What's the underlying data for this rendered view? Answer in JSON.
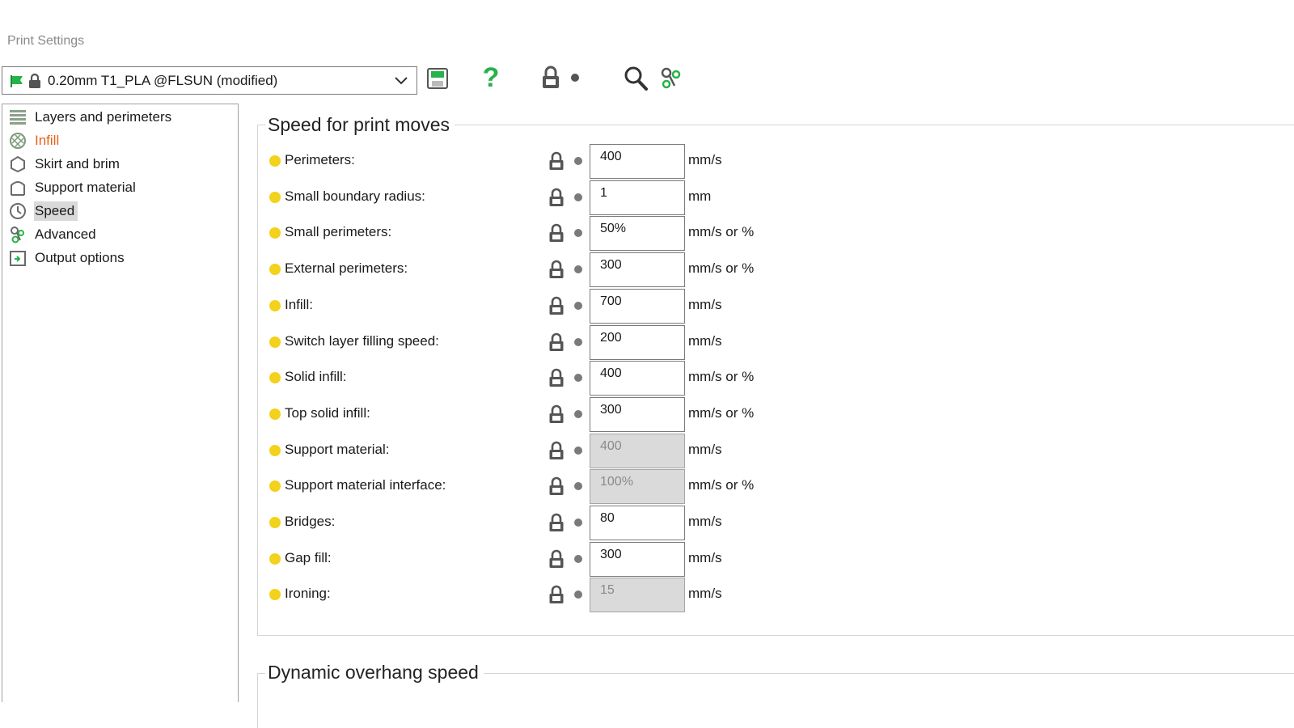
{
  "window": {
    "title": "Print Settings"
  },
  "toolbar": {
    "preset_value": "0.20mm T1_PLA @FLSUN (modified)",
    "help_glyph": "?",
    "icons": [
      "save-preset-icon",
      "help-icon",
      "lock-icon",
      "dot-icon",
      "search-icon",
      "compare-presets-icon"
    ]
  },
  "colors": {
    "accent_green": "#27b24a",
    "active_orange": "#e8601a",
    "bullet_yellow": "#f2d21b",
    "selected_bg": "#d9d9d9",
    "disabled_input_bg": "#dadada"
  },
  "sidebar": {
    "items": [
      {
        "label": "Layers and perimeters",
        "icon": "layers-icon",
        "state": "normal"
      },
      {
        "label": "Infill",
        "icon": "infill-icon",
        "state": "modified"
      },
      {
        "label": "Skirt and brim",
        "icon": "skirt-icon",
        "state": "normal"
      },
      {
        "label": "Support material",
        "icon": "support-icon",
        "state": "normal"
      },
      {
        "label": "Speed",
        "icon": "speed-icon",
        "state": "selected"
      },
      {
        "label": "Advanced",
        "icon": "advanced-icon",
        "state": "normal"
      },
      {
        "label": "Output options",
        "icon": "output-icon",
        "state": "normal"
      }
    ]
  },
  "main": {
    "group_title": "Speed for print moves",
    "group2_title": "Dynamic overhang speed",
    "rows": [
      {
        "label": "Perimeters:",
        "value": "400",
        "unit": "mm/s",
        "disabled": false
      },
      {
        "label": "Small boundary radius:",
        "value": "1",
        "unit": "mm",
        "disabled": false
      },
      {
        "label": "Small perimeters:",
        "value": "50%",
        "unit": "mm/s or %",
        "disabled": false
      },
      {
        "label": "External perimeters:",
        "value": "300",
        "unit": "mm/s or %",
        "disabled": false
      },
      {
        "label": "Infill:",
        "value": "700",
        "unit": "mm/s",
        "disabled": false
      },
      {
        "label": "Switch layer filling speed:",
        "value": "200",
        "unit": "mm/s",
        "disabled": false
      },
      {
        "label": "Solid infill:",
        "value": "400",
        "unit": "mm/s or %",
        "disabled": false
      },
      {
        "label": "Top solid infill:",
        "value": "300",
        "unit": "mm/s or %",
        "disabled": false
      },
      {
        "label": "Support material:",
        "value": "400",
        "unit": "mm/s",
        "disabled": true
      },
      {
        "label": "Support material interface:",
        "value": "100%",
        "unit": "mm/s or %",
        "disabled": true
      },
      {
        "label": "Bridges:",
        "value": "80",
        "unit": "mm/s",
        "disabled": false
      },
      {
        "label": "Gap fill:",
        "value": "300",
        "unit": "mm/s",
        "disabled": false
      },
      {
        "label": "Ironing:",
        "value": "15",
        "unit": "mm/s",
        "disabled": true
      }
    ]
  }
}
